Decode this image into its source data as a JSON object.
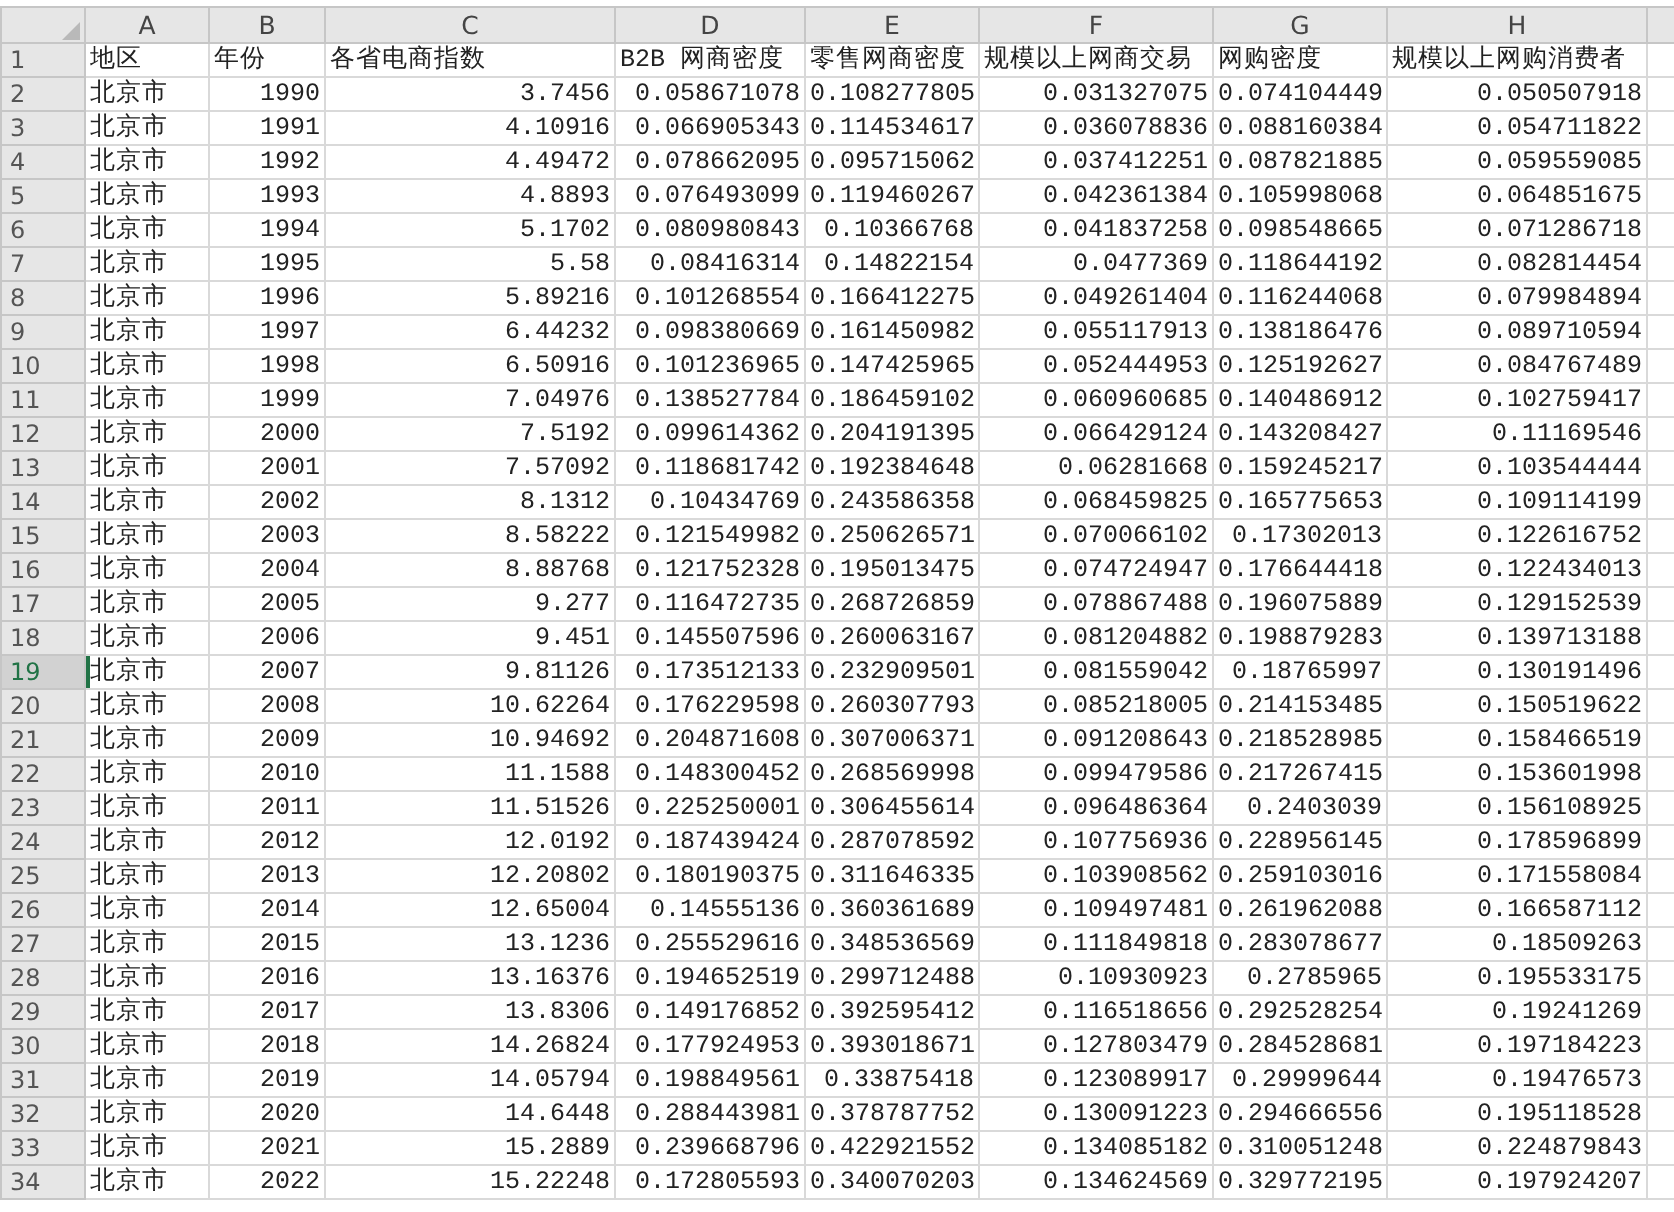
{
  "columns": [
    {
      "label": "A",
      "selected": false
    },
    {
      "label": "B",
      "selected": false
    },
    {
      "label": "C",
      "selected": false
    },
    {
      "label": "D",
      "selected": false
    },
    {
      "label": "E",
      "selected": false
    },
    {
      "label": "F",
      "selected": false
    },
    {
      "label": "G",
      "selected": false
    },
    {
      "label": "H",
      "selected": false
    }
  ],
  "rows": [
    {
      "number": "1",
      "selected": false,
      "kind": "text",
      "cells": [
        "地区",
        "年份",
        "各省电商指数",
        "B2B 网商密度",
        "零售网商密度",
        "规模以上网商交易",
        "网购密度",
        "规模以上网购消费者"
      ]
    },
    {
      "number": "2",
      "selected": false,
      "kind": "data",
      "cells": [
        "北京市",
        "1990",
        "3.7456",
        "0.058671078",
        "0.108277805",
        "0.031327075",
        "0.074104449",
        "0.050507918"
      ]
    },
    {
      "number": "3",
      "selected": false,
      "kind": "data",
      "cells": [
        "北京市",
        "1991",
        "4.10916",
        "0.066905343",
        "0.114534617",
        "0.036078836",
        "0.088160384",
        "0.054711822"
      ]
    },
    {
      "number": "4",
      "selected": false,
      "kind": "data",
      "cells": [
        "北京市",
        "1992",
        "4.49472",
        "0.078662095",
        "0.095715062",
        "0.037412251",
        "0.087821885",
        "0.059559085"
      ]
    },
    {
      "number": "5",
      "selected": false,
      "kind": "data",
      "cells": [
        "北京市",
        "1993",
        "4.8893",
        "0.076493099",
        "0.119460267",
        "0.042361384",
        "0.105998068",
        "0.064851675"
      ]
    },
    {
      "number": "6",
      "selected": false,
      "kind": "data",
      "cells": [
        "北京市",
        "1994",
        "5.1702",
        "0.080980843",
        "0.10366768",
        "0.041837258",
        "0.098548665",
        "0.071286718"
      ]
    },
    {
      "number": "7",
      "selected": false,
      "kind": "data",
      "cells": [
        "北京市",
        "1995",
        "5.58",
        "0.08416314",
        "0.14822154",
        "0.0477369",
        "0.118644192",
        "0.082814454"
      ]
    },
    {
      "number": "8",
      "selected": false,
      "kind": "data",
      "cells": [
        "北京市",
        "1996",
        "5.89216",
        "0.101268554",
        "0.166412275",
        "0.049261404",
        "0.116244068",
        "0.079984894"
      ]
    },
    {
      "number": "9",
      "selected": false,
      "kind": "data",
      "cells": [
        "北京市",
        "1997",
        "6.44232",
        "0.098380669",
        "0.161450982",
        "0.055117913",
        "0.138186476",
        "0.089710594"
      ]
    },
    {
      "number": "10",
      "selected": false,
      "kind": "data",
      "cells": [
        "北京市",
        "1998",
        "6.50916",
        "0.101236965",
        "0.147425965",
        "0.052444953",
        "0.125192627",
        "0.084767489"
      ]
    },
    {
      "number": "11",
      "selected": false,
      "kind": "data",
      "cells": [
        "北京市",
        "1999",
        "7.04976",
        "0.138527784",
        "0.186459102",
        "0.060960685",
        "0.140486912",
        "0.102759417"
      ]
    },
    {
      "number": "12",
      "selected": false,
      "kind": "data",
      "cells": [
        "北京市",
        "2000",
        "7.5192",
        "0.099614362",
        "0.204191395",
        "0.066429124",
        "0.143208427",
        "0.11169546"
      ]
    },
    {
      "number": "13",
      "selected": false,
      "kind": "data",
      "cells": [
        "北京市",
        "2001",
        "7.57092",
        "0.118681742",
        "0.192384648",
        "0.06281668",
        "0.159245217",
        "0.103544444"
      ]
    },
    {
      "number": "14",
      "selected": false,
      "kind": "data",
      "cells": [
        "北京市",
        "2002",
        "8.1312",
        "0.10434769",
        "0.243586358",
        "0.068459825",
        "0.165775653",
        "0.109114199"
      ]
    },
    {
      "number": "15",
      "selected": false,
      "kind": "data",
      "cells": [
        "北京市",
        "2003",
        "8.58222",
        "0.121549982",
        "0.250626571",
        "0.070066102",
        "0.17302013",
        "0.122616752"
      ]
    },
    {
      "number": "16",
      "selected": false,
      "kind": "data",
      "cells": [
        "北京市",
        "2004",
        "8.88768",
        "0.121752328",
        "0.195013475",
        "0.074724947",
        "0.176644418",
        "0.122434013"
      ]
    },
    {
      "number": "17",
      "selected": false,
      "kind": "data",
      "cells": [
        "北京市",
        "2005",
        "9.277",
        "0.116472735",
        "0.268726859",
        "0.078867488",
        "0.196075889",
        "0.129152539"
      ]
    },
    {
      "number": "18",
      "selected": false,
      "kind": "data",
      "cells": [
        "北京市",
        "2006",
        "9.451",
        "0.145507596",
        "0.260063167",
        "0.081204882",
        "0.198879283",
        "0.139713188"
      ]
    },
    {
      "number": "19",
      "selected": true,
      "kind": "data",
      "cells": [
        "北京市",
        "2007",
        "9.81126",
        "0.173512133",
        "0.232909501",
        "0.081559042",
        "0.18765997",
        "0.130191496"
      ]
    },
    {
      "number": "20",
      "selected": false,
      "kind": "data",
      "cells": [
        "北京市",
        "2008",
        "10.62264",
        "0.176229598",
        "0.260307793",
        "0.085218005",
        "0.214153485",
        "0.150519622"
      ]
    },
    {
      "number": "21",
      "selected": false,
      "kind": "data",
      "cells": [
        "北京市",
        "2009",
        "10.94692",
        "0.204871608",
        "0.307006371",
        "0.091208643",
        "0.218528985",
        "0.158466519"
      ]
    },
    {
      "number": "22",
      "selected": false,
      "kind": "data",
      "cells": [
        "北京市",
        "2010",
        "11.1588",
        "0.148300452",
        "0.268569998",
        "0.099479586",
        "0.217267415",
        "0.153601998"
      ]
    },
    {
      "number": "23",
      "selected": false,
      "kind": "data",
      "cells": [
        "北京市",
        "2011",
        "11.51526",
        "0.225250001",
        "0.306455614",
        "0.096486364",
        "0.2403039",
        "0.156108925"
      ]
    },
    {
      "number": "24",
      "selected": false,
      "kind": "data",
      "cells": [
        "北京市",
        "2012",
        "12.0192",
        "0.187439424",
        "0.287078592",
        "0.107756936",
        "0.228956145",
        "0.178596899"
      ]
    },
    {
      "number": "25",
      "selected": false,
      "kind": "data",
      "cells": [
        "北京市",
        "2013",
        "12.20802",
        "0.180190375",
        "0.311646335",
        "0.103908562",
        "0.259103016",
        "0.171558084"
      ]
    },
    {
      "number": "26",
      "selected": false,
      "kind": "data",
      "cells": [
        "北京市",
        "2014",
        "12.65004",
        "0.14555136",
        "0.360361689",
        "0.109497481",
        "0.261962088",
        "0.166587112"
      ]
    },
    {
      "number": "27",
      "selected": false,
      "kind": "data",
      "cells": [
        "北京市",
        "2015",
        "13.1236",
        "0.255529616",
        "0.348536569",
        "0.111849818",
        "0.283078677",
        "0.18509263"
      ]
    },
    {
      "number": "28",
      "selected": false,
      "kind": "data",
      "cells": [
        "北京市",
        "2016",
        "13.16376",
        "0.194652519",
        "0.299712488",
        "0.10930923",
        "0.2785965",
        "0.195533175"
      ]
    },
    {
      "number": "29",
      "selected": false,
      "kind": "data",
      "cells": [
        "北京市",
        "2017",
        "13.8306",
        "0.149176852",
        "0.392595412",
        "0.116518656",
        "0.292528254",
        "0.19241269"
      ]
    },
    {
      "number": "30",
      "selected": false,
      "kind": "data",
      "cells": [
        "北京市",
        "2018",
        "14.26824",
        "0.177924953",
        "0.393018671",
        "0.127803479",
        "0.284528681",
        "0.197184223"
      ]
    },
    {
      "number": "31",
      "selected": false,
      "kind": "data",
      "cells": [
        "北京市",
        "2019",
        "14.05794",
        "0.198849561",
        "0.33875418",
        "0.123089917",
        "0.29999644",
        "0.19476573"
      ]
    },
    {
      "number": "32",
      "selected": false,
      "kind": "data",
      "cells": [
        "北京市",
        "2020",
        "14.6448",
        "0.288443981",
        "0.378787752",
        "0.130091223",
        "0.294666556",
        "0.195118528"
      ]
    },
    {
      "number": "33",
      "selected": false,
      "kind": "data",
      "cells": [
        "北京市",
        "2021",
        "15.2889",
        "0.239668796",
        "0.422921552",
        "0.134085182",
        "0.310051248",
        "0.224879843"
      ]
    },
    {
      "number": "34",
      "selected": false,
      "kind": "data",
      "cells": [
        "北京市",
        "2022",
        "15.22248",
        "0.172805593",
        "0.340070203",
        "0.134624569",
        "0.329772195",
        "0.197924207"
      ]
    }
  ]
}
